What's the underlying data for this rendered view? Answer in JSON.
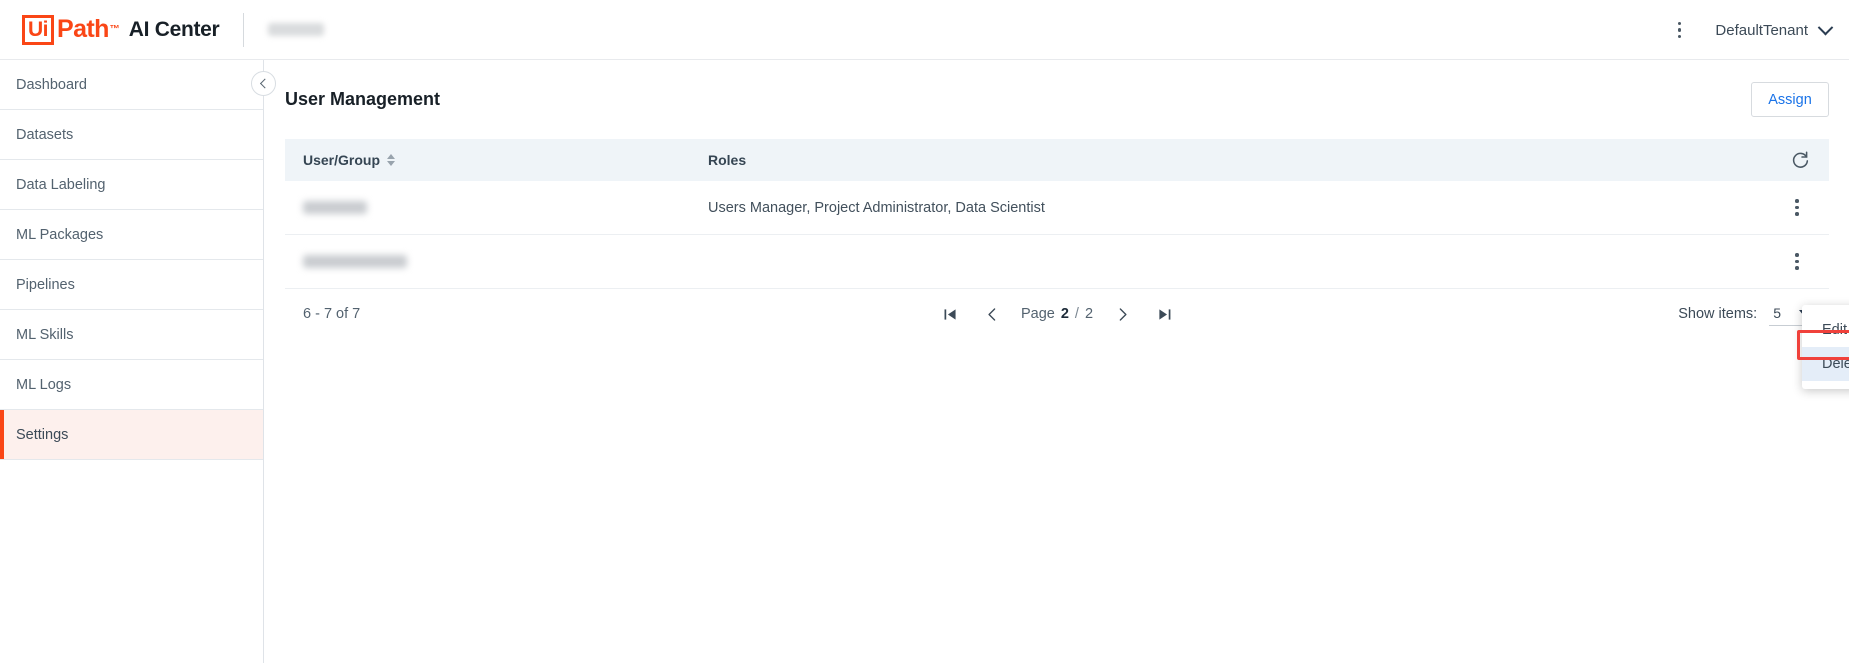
{
  "topbar": {
    "logo_ui": "Ui",
    "logo_path": "Path",
    "logo_tm": "™",
    "product": "AI Center",
    "project_redacted": "",
    "kebab_icon": "more-vertical-icon",
    "tenant": "DefaultTenant",
    "tenant_caret_icon": "chevron-down-icon"
  },
  "sidebar": {
    "collapse_icon": "chevron-left-icon",
    "items": [
      {
        "label": "Dashboard",
        "active": false
      },
      {
        "label": "Datasets",
        "active": false
      },
      {
        "label": "Data Labeling",
        "active": false
      },
      {
        "label": "ML Packages",
        "active": false
      },
      {
        "label": "Pipelines",
        "active": false
      },
      {
        "label": "ML Skills",
        "active": false
      },
      {
        "label": "ML Logs",
        "active": false
      },
      {
        "label": "Settings",
        "active": true
      }
    ]
  },
  "main": {
    "title": "User Management",
    "assign_label": "Assign",
    "table": {
      "columns": [
        {
          "label": "User/Group",
          "sort_icon": "sort-updown-icon"
        },
        {
          "label": "Roles"
        }
      ],
      "refresh_icon": "refresh-icon",
      "rows": [
        {
          "user": "",
          "user_redacted": true,
          "roles": "Users Manager, Project Administrator, Data Scientist",
          "menu_icon": "more-vertical-icon"
        },
        {
          "user": "",
          "user_redacted": true,
          "roles": "",
          "menu_icon": "more-vertical-icon"
        }
      ]
    },
    "pagination": {
      "range": "6 - 7 of 7",
      "first_icon": "first-page-icon",
      "prev_icon": "chevron-left-icon",
      "page_word": "Page",
      "current_page": "2",
      "separator": "/",
      "total_pages": "2",
      "next_icon": "chevron-right-icon",
      "last_icon": "last-page-icon",
      "show_items_label": "Show items:",
      "show_items_value": "5",
      "show_items_caret_icon": "caret-down-icon"
    },
    "context_menu": {
      "items": [
        {
          "label": "Edit",
          "highlighted": false
        },
        {
          "label": "Delete",
          "highlighted": true
        }
      ]
    }
  },
  "colors": {
    "brand_orange": "#fa4616",
    "link_blue": "#1a73e8",
    "annotation_red": "#f0413b",
    "header_bg": "#eff4f8",
    "menu_highlight": "#e4edf8"
  }
}
